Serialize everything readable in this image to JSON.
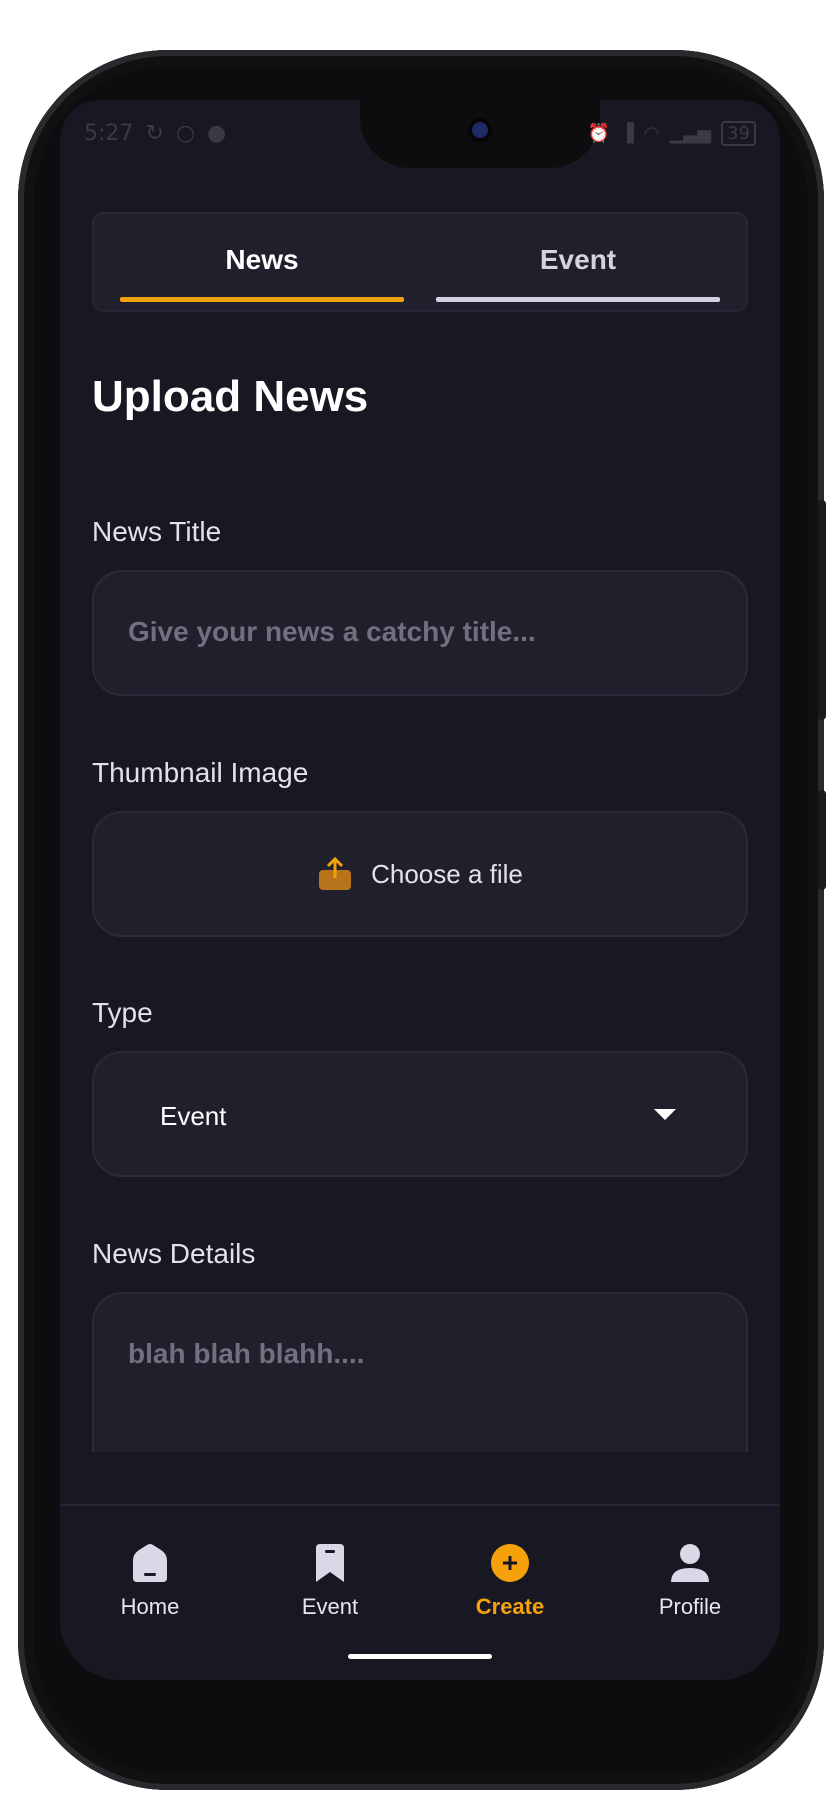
{
  "status_bar": {
    "time": "5:27",
    "battery": "39"
  },
  "tabs": [
    {
      "label": "News",
      "active": true
    },
    {
      "label": "Event",
      "active": false
    }
  ],
  "colors": {
    "accent": "#f5a10b",
    "background": "#181822",
    "card": "#20202c",
    "inactive_tab_underline": "#d0d0e0"
  },
  "page": {
    "title": "Upload News"
  },
  "form": {
    "news_title": {
      "label": "News Title",
      "placeholder": "Give your news a catchy title...",
      "value": ""
    },
    "thumbnail": {
      "label": "Thumbnail Image",
      "button_label": "Choose a file",
      "icon": "upload-icon"
    },
    "type": {
      "label": "Type",
      "selected": "Event"
    },
    "details": {
      "label": "News Details",
      "placeholder": "blah blah blahh...."
    }
  },
  "bottom_nav": [
    {
      "label": "Home",
      "icon": "home-icon",
      "active": false
    },
    {
      "label": "Event",
      "icon": "bookmark-icon",
      "active": false
    },
    {
      "label": "Create",
      "icon": "plus-circle-icon",
      "active": true
    },
    {
      "label": "Profile",
      "icon": "user-icon",
      "active": false
    }
  ]
}
